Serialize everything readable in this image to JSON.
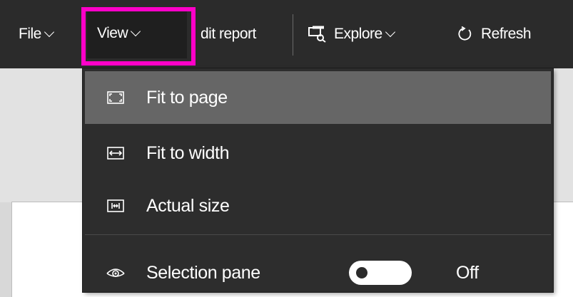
{
  "toolbar": {
    "file_label": "File",
    "view_label": "View",
    "edit_report_label": "dit report",
    "explore_label": "Explore",
    "refresh_label": "Refresh"
  },
  "highlight_color": "#ff00c8",
  "view_menu": {
    "items": [
      {
        "label": "Fit to page",
        "icon": "fit-to-page-icon",
        "active": true
      },
      {
        "label": "Fit to width",
        "icon": "fit-to-width-icon",
        "active": false
      },
      {
        "label": "Actual size",
        "icon": "actual-size-icon",
        "active": false
      }
    ],
    "selection_pane": {
      "label": "Selection pane",
      "icon": "eye-icon",
      "toggle_state": "Off"
    }
  }
}
